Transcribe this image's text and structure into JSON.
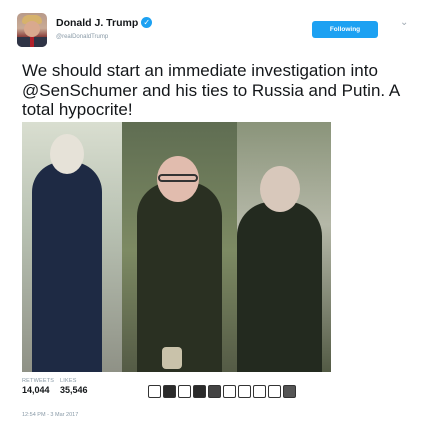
{
  "author": {
    "display_name": "Donald J. Trump",
    "handle": "@realDonaldTrump",
    "verified_glyph": "✓"
  },
  "header": {
    "follow_label": "Following",
    "more_glyph": "⌄"
  },
  "tweet": {
    "text": "We should start an immediate investigation into @SenSchumer and his ties to Russia and Putin. A total hypocrite!"
  },
  "stats": {
    "retweets_label": "RETWEETS",
    "retweets_value": "14,044",
    "likes_label": "LIKES",
    "likes_value": "35,546"
  },
  "likers": [
    {
      "icon": "avatar-icon",
      "color": "#ffffff"
    },
    {
      "icon": "avatar-icon",
      "color": "#2b2b2b"
    },
    {
      "icon": "avatar-icon",
      "color": "#ffffff"
    },
    {
      "icon": "avatar-icon",
      "color": "#2b2b2b"
    },
    {
      "icon": "avatar-icon",
      "color": "#444444"
    },
    {
      "icon": "avatar-icon",
      "color": "#ffffff"
    },
    {
      "icon": "avatar-icon",
      "color": "#ffffff"
    },
    {
      "icon": "avatar-icon",
      "color": "#ffffff"
    },
    {
      "icon": "avatar-icon",
      "color": "#ffffff"
    },
    {
      "icon": "avatar-icon",
      "color": "#555555"
    }
  ],
  "timestamp": "12:54 PM - 3 Mar 2017",
  "colors": {
    "accent": "#1da1f2",
    "text": "#14171a",
    "muted": "#8899a6"
  }
}
